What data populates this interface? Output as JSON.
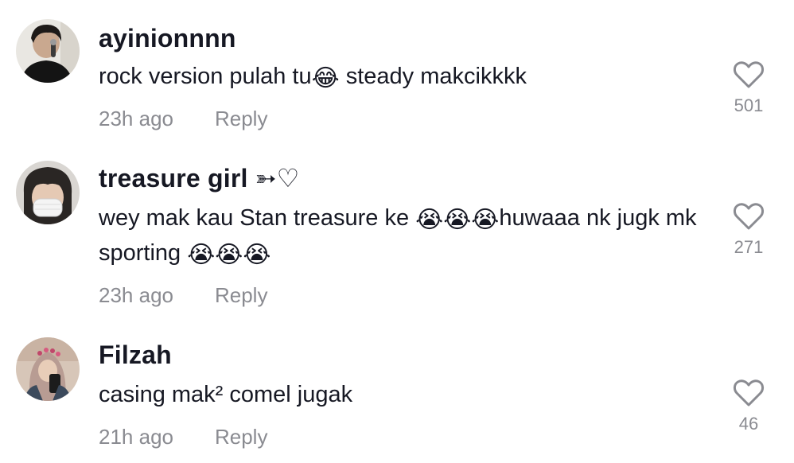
{
  "comments": [
    {
      "username": "ayinionnnn",
      "text_parts": [
        "rock version pulah tu",
        "😂",
        " steady makcikkkk"
      ],
      "time": "23h ago",
      "reply_label": "Reply",
      "likes": "501",
      "avatar_icon": "person-holding-mic-avatar"
    },
    {
      "username": "treasure girl ➳♡",
      "text_parts": [
        "wey mak kau Stan treasure ke ",
        "😭😭😭",
        "huwaaa nk jugk mk sporting ",
        "😭😭😭"
      ],
      "time": "23h ago",
      "reply_label": "Reply",
      "likes": "271",
      "avatar_icon": "masked-person-avatar"
    },
    {
      "username": "Filzah",
      "text_parts": [
        "casing mak² comel jugak"
      ],
      "time": "21h ago",
      "reply_label": "Reply",
      "likes": "46",
      "avatar_icon": "hijab-selfie-avatar"
    }
  ],
  "colors": {
    "text_primary": "#161823",
    "text_secondary": "#8a8b91",
    "heart_outline": "#8a8b91",
    "background": "#ffffff"
  },
  "icons": {
    "like": "heart-outline-icon"
  }
}
